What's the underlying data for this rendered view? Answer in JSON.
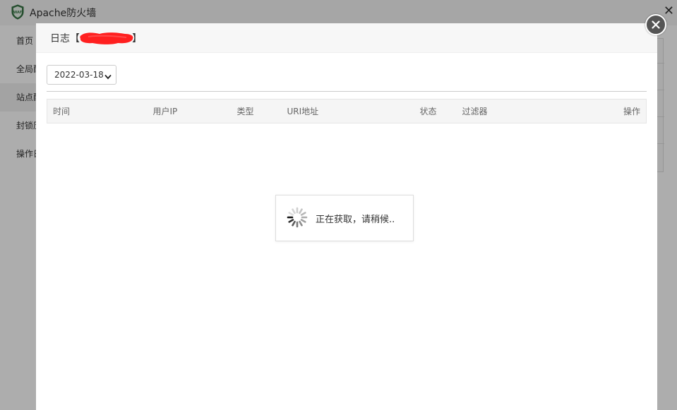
{
  "app": {
    "title": "Apache防火墙",
    "close_glyph": "✕"
  },
  "sidebar": {
    "items": [
      {
        "label": "首页",
        "active": false
      },
      {
        "label": "全局配置",
        "active": false
      },
      {
        "label": "站点配置",
        "active": true
      },
      {
        "label": "封锁历史",
        "active": false
      },
      {
        "label": "操作日志",
        "active": false
      }
    ]
  },
  "modal": {
    "title_prefix": "日志【",
    "title_suffix": "】",
    "date_value": "2022-03-18",
    "table": {
      "columns": [
        "时间",
        "用户IP",
        "类型",
        "URI地址",
        "状态",
        "过滤器",
        "操作"
      ]
    },
    "loading_text": "正在获取，请稍候.."
  },
  "colors": {
    "overlay": "#000000",
    "redaction": "#ff2020",
    "close_button": "#555555"
  },
  "icons": {
    "logo": "shield-waf-icon",
    "modal_close": "close-circle-icon",
    "spinner": "loading-spinner-icon",
    "select_caret": "chevron-down-icon"
  }
}
